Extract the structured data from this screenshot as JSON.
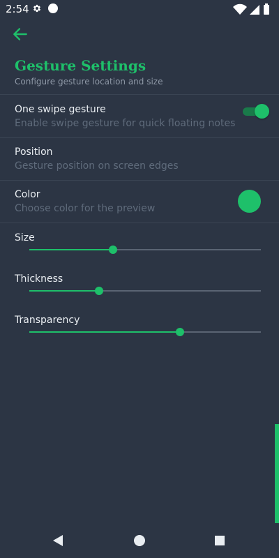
{
  "status": {
    "time": "2:54",
    "icons": [
      "gear-icon",
      "circle-notification-icon",
      "wifi-icon",
      "signal-icon",
      "battery-icon"
    ]
  },
  "toolbar": {
    "back_icon": "arrow-left-icon"
  },
  "header": {
    "title": "Gesture Settings",
    "subtitle": "Configure gesture location and size"
  },
  "settings": [
    {
      "title": "One swipe gesture",
      "description": "Enable swipe gesture for quick floating notes",
      "control": "toggle",
      "enabled": true
    },
    {
      "title": "Position",
      "description": "Gesture position on screen edges",
      "control": "none"
    },
    {
      "title": "Color",
      "description": "Choose color for the preview",
      "control": "color-swatch",
      "color": "#1ec06a"
    }
  ],
  "sliders": [
    {
      "label": "Size",
      "value": 0.36
    },
    {
      "label": "Thickness",
      "value": 0.3
    },
    {
      "label": "Transparency",
      "value": 0.65
    }
  ],
  "nav": {
    "icons": [
      "back-triangle-icon",
      "home-circle-icon",
      "recents-square-icon"
    ]
  },
  "colors": {
    "background": "#2c3544",
    "accent": "#1ec06a",
    "muted_text": "#5f6b7b"
  }
}
